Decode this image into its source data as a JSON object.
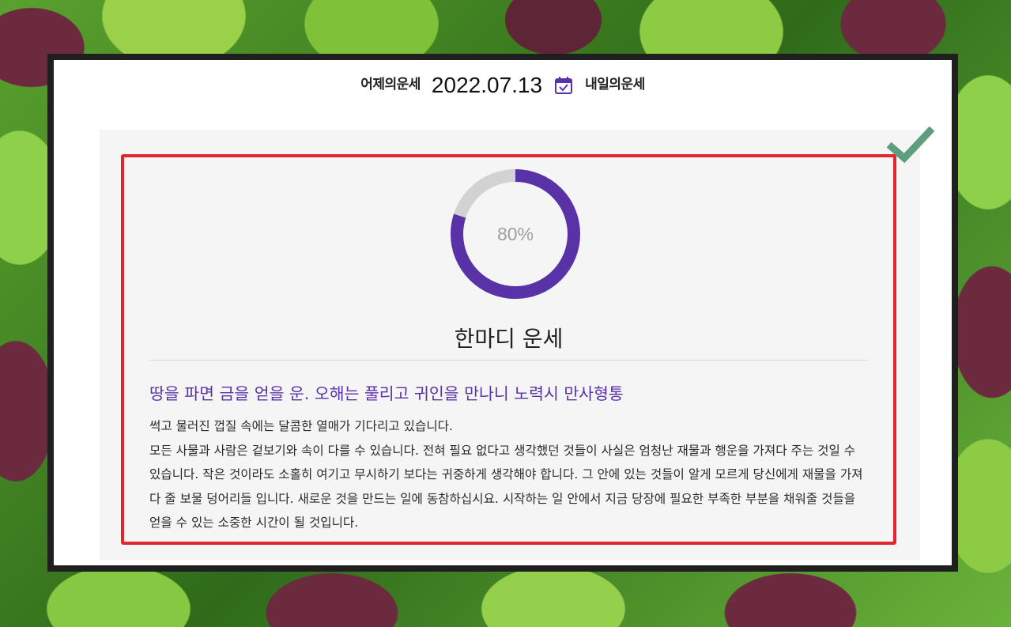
{
  "nav": {
    "prev_label": "어제의운세",
    "date": "2022.07.13",
    "next_label": "내일의운세",
    "calendar_icon": "calendar-check-icon"
  },
  "fortune": {
    "score_percent": 80,
    "score_label": "80%",
    "title": "한마디 운세",
    "headline": "땅을 파면 금을 얻을 운. 오해는 풀리고 귀인을 만나니 노력시 만사형통",
    "body_lines": [
      "썩고 물러진 껍질 속에는 달콤한 열매가 기다리고 있습니다.",
      "모든 사물과 사람은 겉보기와 속이 다를 수 있습니다. 전혀 필요 없다고 생각했던 것들이 사실은 엄청난 재물과 행운을 가져다 주는 것일 수 있습니다. 작은 것이라도 소홀히 여기고 무시하기 보다는 귀중하게 생각해야 합니다. 그 안에 있는 것들이 알게 모르게 당신에게 재물을 가져 다 줄 보물 덩어리들 입니다. 새로운 것을 만드는 일에 동참하십시요. 시작하는 일 안에서 지금 당장에 필요한 부족한 부분을 채워줄 것들을 얻을 수 있는 소중한 시간이 될 것입니다."
    ]
  },
  "colors": {
    "accent": "#5a32a8",
    "donut_track": "#d2d2d2",
    "highlight_frame": "#e0262e",
    "check": "#5e9e7e"
  },
  "icons": {
    "check": "check-mark-icon"
  }
}
